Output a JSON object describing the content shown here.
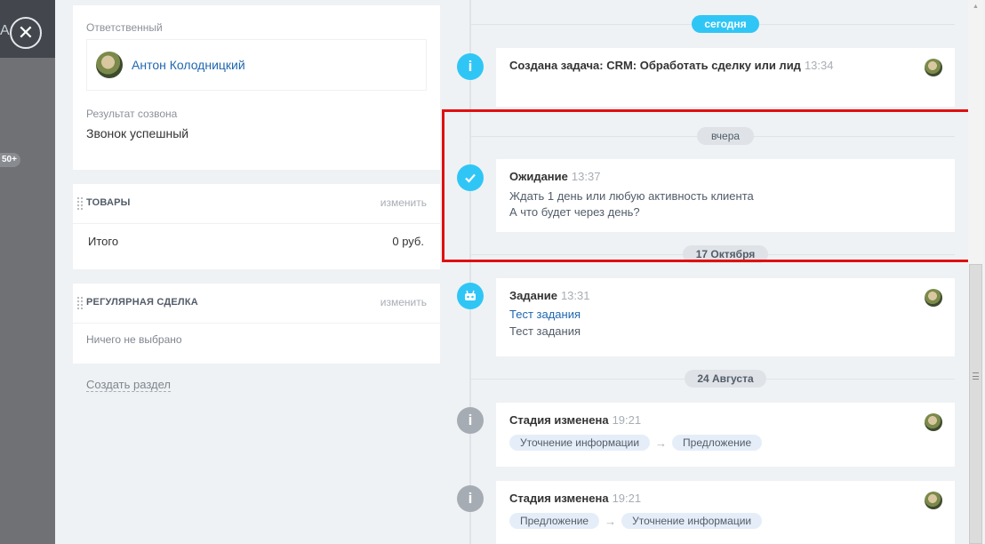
{
  "overlay": {
    "badge": "50+",
    "letter": "A"
  },
  "close_icon_glyph": "✕",
  "responsible": {
    "label": "Ответственный",
    "name": "Антон Колодницкий"
  },
  "call_result": {
    "label": "Результат созвона",
    "value": "Звонок успешный"
  },
  "products": {
    "title": "ТОВАРЫ",
    "edit": "изменить",
    "total_label": "Итого",
    "total_value": "0 руб."
  },
  "regular_deal": {
    "title": "РЕГУЛЯРНАЯ СДЕЛКА",
    "edit": "изменить",
    "empty": "Ничего не выбрано"
  },
  "create_section": "Создать раздел",
  "timeline": {
    "dates": {
      "today": "сегодня",
      "yesterday": "вчера",
      "oct17": "17 Октября",
      "aug24": "24 Августа"
    },
    "items": [
      {
        "icon": "info-icon",
        "title": "Создана задача: CRM: Обработать сделку или лид",
        "time": "13:34"
      },
      {
        "icon": "check-icon",
        "title": "Ожидание",
        "time": "13:37",
        "line1": "Ждать 1 день или любую активность клиента",
        "line2": "А что будет через день?"
      },
      {
        "icon": "robot-icon",
        "title": "Задание",
        "time": "13:31",
        "link": "Тест задания",
        "text": "Тест задания"
      },
      {
        "icon": "info-icon",
        "title": "Стадия изменена",
        "time": "19:21",
        "from": "Уточнение информации",
        "to": "Предложение"
      },
      {
        "icon": "info-icon",
        "title": "Стадия изменена",
        "time": "19:21",
        "from": "Предложение",
        "to": "Уточнение информации"
      }
    ],
    "arrow_glyph": "→"
  },
  "colors": {
    "accent": "#2fc6f6",
    "link": "#2067b0",
    "highlight": "#e01010",
    "stage_bg": "#e5eef8"
  }
}
